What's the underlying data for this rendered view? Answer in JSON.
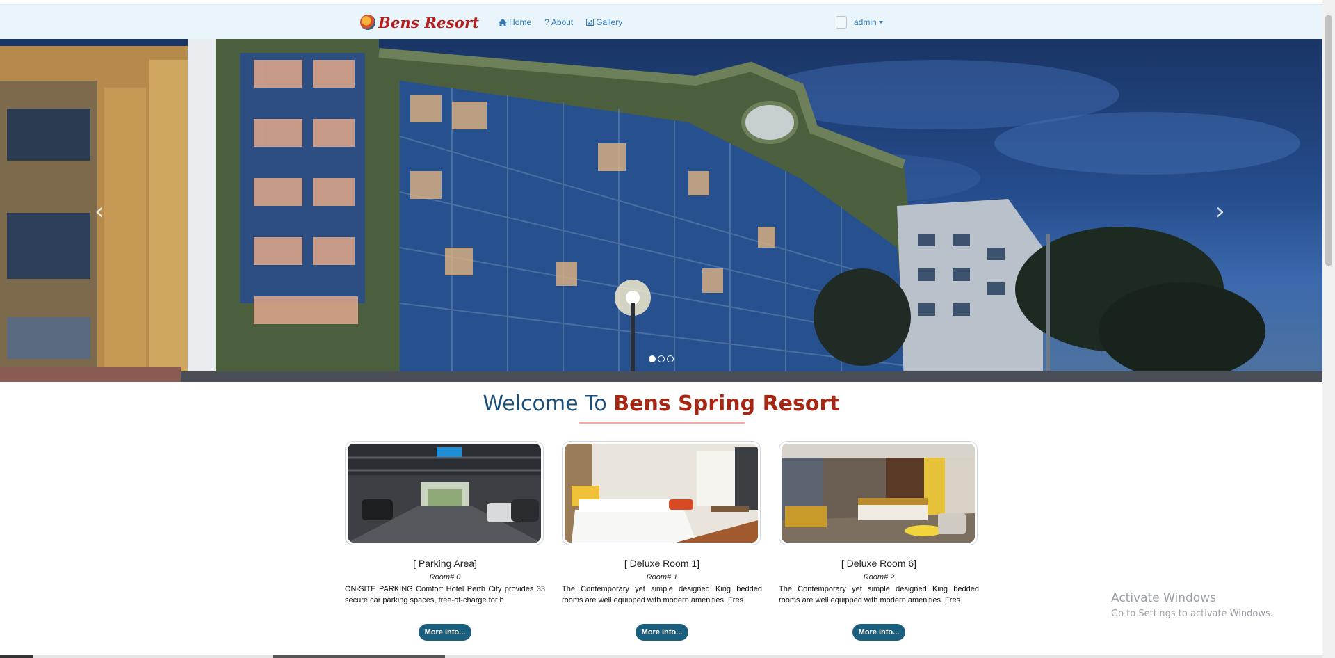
{
  "navbar": {
    "brand": "Bens Resort",
    "links": [
      {
        "label": "Home",
        "icon": "home-icon"
      },
      {
        "label": "About",
        "icon": "question-icon"
      },
      {
        "label": "Gallery",
        "icon": "picture-icon"
      }
    ],
    "user": "admin"
  },
  "carousel": {
    "prev_icon": "chevron-left-icon",
    "next_icon": "chevron-right-icon",
    "slide_count": 3,
    "active_slide": 1
  },
  "welcome": {
    "prefix": "Welcome To",
    "name": "Bens Spring Resort"
  },
  "cards": [
    {
      "title": "[ Parking Area]",
      "room": "Room# 0",
      "description": "ON-SITE PARKING Comfort Hotel Perth City provides 33 secure car parking spaces, free-of-charge for h",
      "button": "More info..."
    },
    {
      "title": "[ Deluxe Room 1]",
      "room": "Room# 1",
      "description": "The Contemporary yet simple designed King bedded rooms are well equipped with modern amenities. Fres",
      "button": "More info..."
    },
    {
      "title": "[ Deluxe Room 6]",
      "room": "Room# 2",
      "description": "The Contemporary yet simple designed King bedded rooms are well equipped with modern amenities. Fres",
      "button": "More info..."
    }
  ],
  "windows_watermark": {
    "line1": "Activate Windows",
    "line2": "Go to Settings to activate Windows."
  },
  "colors": {
    "navbar_bg": "#eaf4fb",
    "link": "#2f78b4",
    "brand": "#b71c1c",
    "heading_blue": "#1c4f78",
    "heading_red": "#a52714",
    "button_bg": "#1b5f7f"
  }
}
